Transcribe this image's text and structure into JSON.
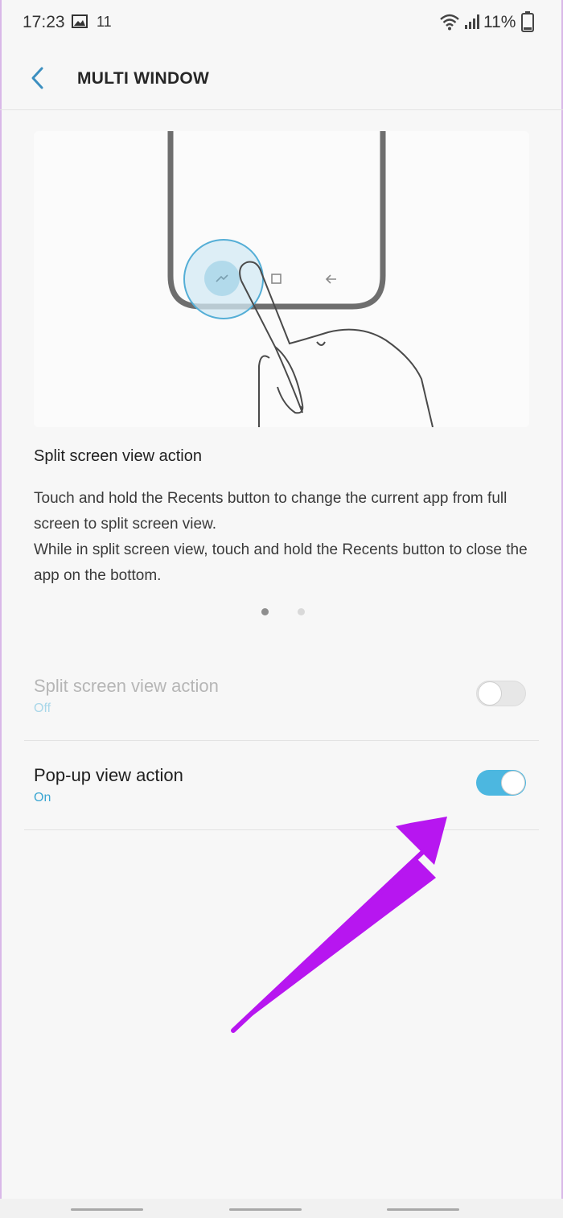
{
  "status_bar": {
    "time": "17:23",
    "notification_count": "11",
    "battery_percent": "11%",
    "icons": [
      "gallery-icon",
      "wifi-icon",
      "signal-icon",
      "battery-icon"
    ]
  },
  "app_bar": {
    "title": "MULTI WINDOW",
    "back_icon": "chevron-left-icon"
  },
  "tutorial": {
    "title": "Split screen view action",
    "description": [
      "Touch and hold the Recents button to change the current app from full screen to split screen view.",
      "While in split screen view, touch and hold the Recents button to close the app on the bottom."
    ],
    "page_indicator": {
      "current": 1,
      "total": 2
    }
  },
  "settings": [
    {
      "label": "Split screen view action",
      "status": "Off",
      "enabled": false,
      "disabled_look": true
    },
    {
      "label": "Pop-up view action",
      "status": "On",
      "enabled": true,
      "disabled_look": false
    }
  ],
  "colors": {
    "accent": "#4cb7e0",
    "annotation_arrow": "#b716f0",
    "background": "#f7f7f7"
  }
}
